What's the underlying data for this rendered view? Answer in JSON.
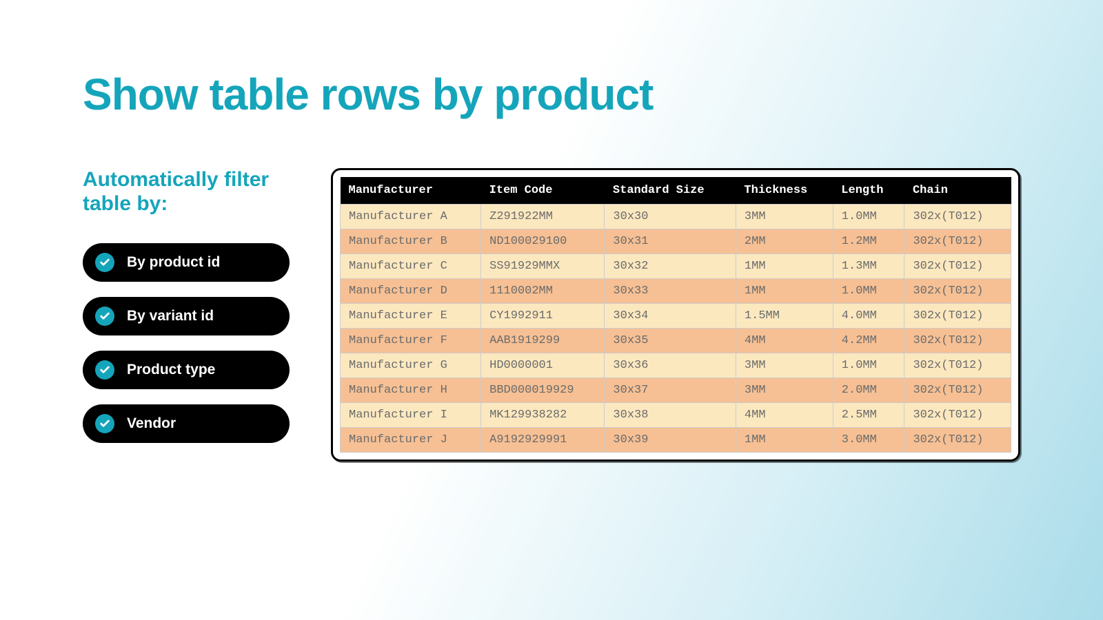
{
  "title": "Show table rows by product",
  "subtitle": "Automatically filter table by:",
  "filters": [
    {
      "label": "By product id",
      "checked": true
    },
    {
      "label": "By variant id",
      "checked": true
    },
    {
      "label": "Product type",
      "checked": true
    },
    {
      "label": "Vendor",
      "checked": true
    }
  ],
  "table": {
    "headers": [
      "Manufacturer",
      "Item Code",
      "Standard Size",
      "Thickness",
      "Length",
      "Chain"
    ],
    "rows": [
      [
        "Manufacturer A",
        "Z291922MM",
        "30x30",
        "3MM",
        "1.0MM",
        "302x(T012)"
      ],
      [
        "Manufacturer B",
        "ND100029100",
        "30x31",
        "2MM",
        "1.2MM",
        "302x(T012)"
      ],
      [
        "Manufacturer C",
        "SS91929MMX",
        "30x32",
        "1MM",
        "1.3MM",
        "302x(T012)"
      ],
      [
        "Manufacturer D",
        "1110002MM",
        "30x33",
        "1MM",
        "1.0MM",
        "302x(T012)"
      ],
      [
        "Manufacturer E",
        "CY1992911",
        "30x34",
        "1.5MM",
        "4.0MM",
        "302x(T012)"
      ],
      [
        "Manufacturer F",
        "AAB1919299",
        "30x35",
        "4MM",
        "4.2MM",
        "302x(T012)"
      ],
      [
        "Manufacturer G",
        "HD0000001",
        "30x36",
        "3MM",
        "1.0MM",
        "302x(T012)"
      ],
      [
        "Manufacturer H",
        "BBD000019929",
        "30x37",
        "3MM",
        "2.0MM",
        "302x(T012)"
      ],
      [
        "Manufacturer I",
        "MK129938282",
        "30x38",
        "4MM",
        "2.5MM",
        "302x(T012)"
      ],
      [
        "Manufacturer J",
        "A9192929991",
        "30x39",
        "1MM",
        "3.0MM",
        "302x(T012)"
      ]
    ]
  }
}
